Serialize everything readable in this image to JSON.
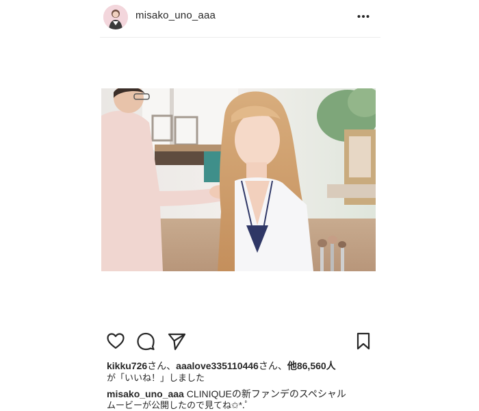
{
  "header": {
    "username": "misako_uno_aaa",
    "avatar_icon": "profile-avatar",
    "more_icon": "more-horizontal-icon"
  },
  "post": {
    "photo_description_icon": "makeup-photo"
  },
  "actions": {
    "like_icon": "heart-icon",
    "comment_icon": "comment-bubble-icon",
    "share_icon": "paper-plane-icon",
    "save_icon": "bookmark-icon"
  },
  "likes": {
    "user1": "kikku726",
    "sep1": "さん、",
    "user2": "aaalove335110446",
    "sep2": "さん、",
    "others": "他86,560人",
    "suffix": "が「いいね！」しました"
  },
  "caption": {
    "username": "misako_uno_aaa",
    "text_line1": " CLINIQUEの新ファンデのスペシャル",
    "text_line2": "ムービーが公開したので見てね✩*.ﾟ"
  },
  "colors": {
    "text": "#262626",
    "divider": "#ececec",
    "background": "#ffffff"
  }
}
